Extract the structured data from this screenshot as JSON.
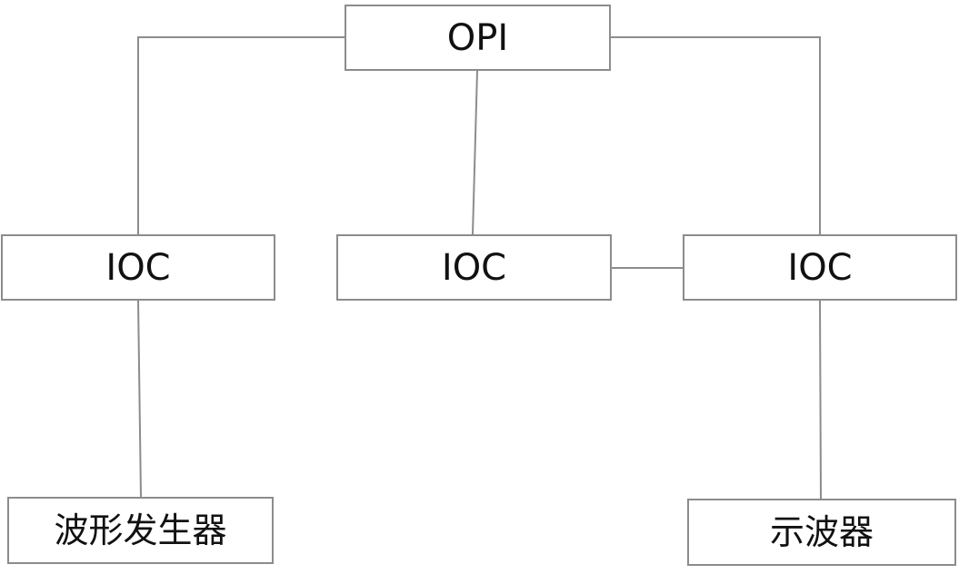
{
  "diagram": {
    "nodes": {
      "opi": "OPI",
      "ioc_left": "IOC",
      "ioc_middle": "IOC",
      "ioc_right": "IOC",
      "waveform_generator": "波形发生器",
      "oscilloscope": "示波器"
    },
    "edges": [
      [
        "opi",
        "ioc_left"
      ],
      [
        "opi",
        "ioc_middle"
      ],
      [
        "opi",
        "ioc_right"
      ],
      [
        "ioc_middle",
        "ioc_right"
      ],
      [
        "ioc_left",
        "waveform_generator"
      ],
      [
        "ioc_right",
        "oscilloscope"
      ]
    ],
    "colors": {
      "line": "#8c8c8c",
      "border": "#8c8c8c",
      "text": "#111111",
      "background": "#ffffff"
    }
  }
}
